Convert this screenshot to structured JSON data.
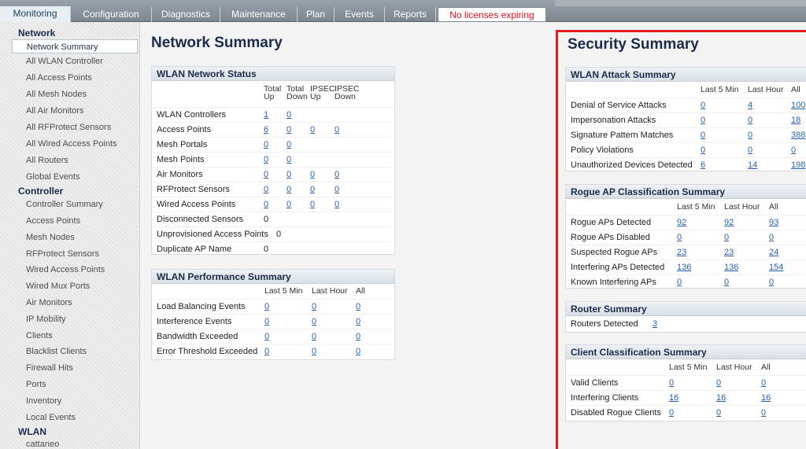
{
  "tabs": [
    {
      "label": "Monitoring"
    },
    {
      "label": "Configuration"
    },
    {
      "label": "Diagnostics"
    },
    {
      "label": "Maintenance"
    },
    {
      "label": "Plan"
    },
    {
      "label": "Events"
    },
    {
      "label": "Reports"
    },
    {
      "label": "No licenses expiring"
    }
  ],
  "sidebar": {
    "network_title": "Network",
    "network_items": [
      "Network Summary",
      "All WLAN Controller",
      "All Access Points",
      "All Mesh Nodes",
      "All Air Monitors",
      "All RFProtect Sensors",
      "All Wired Access Points",
      "All Routers",
      "Global Events"
    ],
    "controller_title": "Controller",
    "controller_items": [
      "Controller Summary",
      "Access Points",
      "Mesh Nodes",
      "RFProtect Sensors",
      "Wired Access Points",
      "Wired Mux Ports",
      "Air Monitors",
      "IP Mobility",
      "Clients",
      "Blacklist Clients",
      "Firewall Hits",
      "Ports",
      "Inventory",
      "Local Events"
    ],
    "wlan_title": "WLAN",
    "wlan_items": [
      "cattaneo"
    ]
  },
  "network_summary": {
    "title": "Network Summary",
    "status": {
      "title": "WLAN Network Status",
      "columns": [
        [
          "Total",
          "Up"
        ],
        [
          "Total",
          "Down"
        ],
        [
          "IPSEC",
          "Up"
        ],
        [
          "IPSEC",
          "Down"
        ]
      ],
      "rows": [
        {
          "label": "WLAN Controllers",
          "values": [
            "1",
            "0",
            "",
            ""
          ]
        },
        {
          "label": "Access Points",
          "values": [
            "6",
            "0",
            "0",
            "0"
          ]
        },
        {
          "label": "Mesh Portals",
          "values": [
            "0",
            "0",
            "",
            ""
          ]
        },
        {
          "label": "Mesh Points",
          "values": [
            "0",
            "0",
            "",
            ""
          ]
        },
        {
          "label": "Air Monitors",
          "values": [
            "0",
            "0",
            "0",
            "0"
          ]
        },
        {
          "label": "RFProtect Sensors",
          "values": [
            "0",
            "0",
            "0",
            "0"
          ]
        },
        {
          "label": "Wired Access Points",
          "values": [
            "0",
            "0",
            "0",
            "0"
          ]
        },
        {
          "label": "Disconnected Sensors",
          "values": [
            "0",
            "",
            "",
            ""
          ]
        },
        {
          "label": "Unprovisioned Access Points",
          "values": [
            "0",
            "",
            "",
            ""
          ]
        },
        {
          "label": "Duplicate AP Name",
          "values": [
            "0",
            "",
            "",
            ""
          ]
        }
      ]
    },
    "performance": {
      "title": "WLAN Performance Summary",
      "columns": [
        "Last 5 Min",
        "Last Hour",
        "All"
      ],
      "rows": [
        {
          "label": "Load Balancing Events",
          "values": [
            "0",
            "0",
            "0"
          ]
        },
        {
          "label": "Interference Events",
          "values": [
            "0",
            "0",
            "0"
          ]
        },
        {
          "label": "Bandwidth Exceeded",
          "values": [
            "0",
            "0",
            "0"
          ]
        },
        {
          "label": "Error Threshold Exceeded",
          "values": [
            "0",
            "0",
            "0"
          ]
        }
      ]
    }
  },
  "security_summary": {
    "title": "Security Summary",
    "attack": {
      "title": "WLAN Attack Summary",
      "columns": [
        "Last 5 Min",
        "Last Hour",
        "All"
      ],
      "rows": [
        {
          "label": "Denial of Service Attacks",
          "values": [
            "0",
            "4",
            "100"
          ]
        },
        {
          "label": "Impersonation Attacks",
          "values": [
            "0",
            "0",
            "18"
          ]
        },
        {
          "label": "Signature Pattern Matches",
          "values": [
            "0",
            "0",
            "388"
          ]
        },
        {
          "label": "Policy Violations",
          "values": [
            "0",
            "0",
            "0"
          ]
        },
        {
          "label": "Unauthorized Devices Detected",
          "values": [
            "6",
            "14",
            "198"
          ]
        }
      ]
    },
    "rogue": {
      "title": "Rogue AP Classification Summary",
      "columns": [
        "Last 5 Min",
        "Last Hour",
        "All"
      ],
      "rows": [
        {
          "label": "Rogue APs Detected",
          "values": [
            "92",
            "92",
            "93"
          ]
        },
        {
          "label": "Rogue APs Disabled",
          "values": [
            "0",
            "0",
            "0"
          ]
        },
        {
          "label": "Suspected Rogue APs",
          "values": [
            "23",
            "23",
            "24"
          ]
        },
        {
          "label": "Interfering APs Detected",
          "values": [
            "136",
            "136",
            "154"
          ]
        },
        {
          "label": "Known Interfering APs",
          "values": [
            "0",
            "0",
            "0"
          ]
        }
      ]
    },
    "router": {
      "title": "Router Summary",
      "label": "Routers Detected",
      "value": "3"
    },
    "client": {
      "title": "Client Classification Summary",
      "columns": [
        "Last 5 Min",
        "Last Hour",
        "All"
      ],
      "rows": [
        {
          "label": "Valid Clients",
          "values": [
            "0",
            "0",
            "0"
          ]
        },
        {
          "label": "Interfering Clients",
          "values": [
            "16",
            "16",
            "16"
          ]
        },
        {
          "label": "Disabled Rogue Clients",
          "values": [
            "0",
            "0",
            "0"
          ]
        }
      ]
    }
  }
}
